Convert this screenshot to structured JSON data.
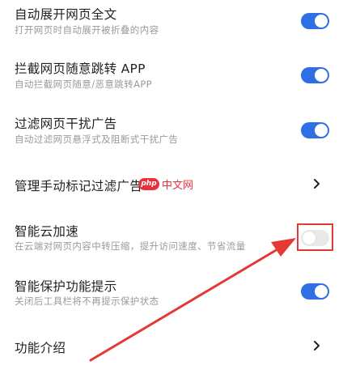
{
  "settings": {
    "items": [
      {
        "title": "自动展开网页全文",
        "subtitle": "打开网页时自动展开被折叠的内容",
        "control": "toggle",
        "on": true
      },
      {
        "title": "拦截网页随意跳转 APP",
        "subtitle": "自动拦截网页随意/恶意跳转APP",
        "control": "toggle",
        "on": true
      },
      {
        "title": "过滤网页干扰广告",
        "subtitle": "自动过滤网页悬浮式及阻断式干扰广告",
        "control": "toggle",
        "on": true
      },
      {
        "title": "管理手动标记过滤广告",
        "subtitle": "",
        "control": "chevron"
      },
      {
        "title": "智能云加速",
        "subtitle": "在云端对网页内容中转压缩，提升访问速度、节省流量",
        "control": "toggle",
        "on": false
      },
      {
        "title": "智能保护功能提示",
        "subtitle": "关闭后工具栏将不再提示保护状态",
        "control": "toggle",
        "on": true
      },
      {
        "title": "功能介绍",
        "subtitle": "",
        "control": "chevron"
      }
    ]
  },
  "watermark": {
    "badge": "php",
    "text": "中文网"
  },
  "colors": {
    "toggle_on": "#2e6fe3",
    "toggle_off": "#e9e9e9",
    "annotation": "#e53935",
    "watermark": "#e8313a"
  }
}
